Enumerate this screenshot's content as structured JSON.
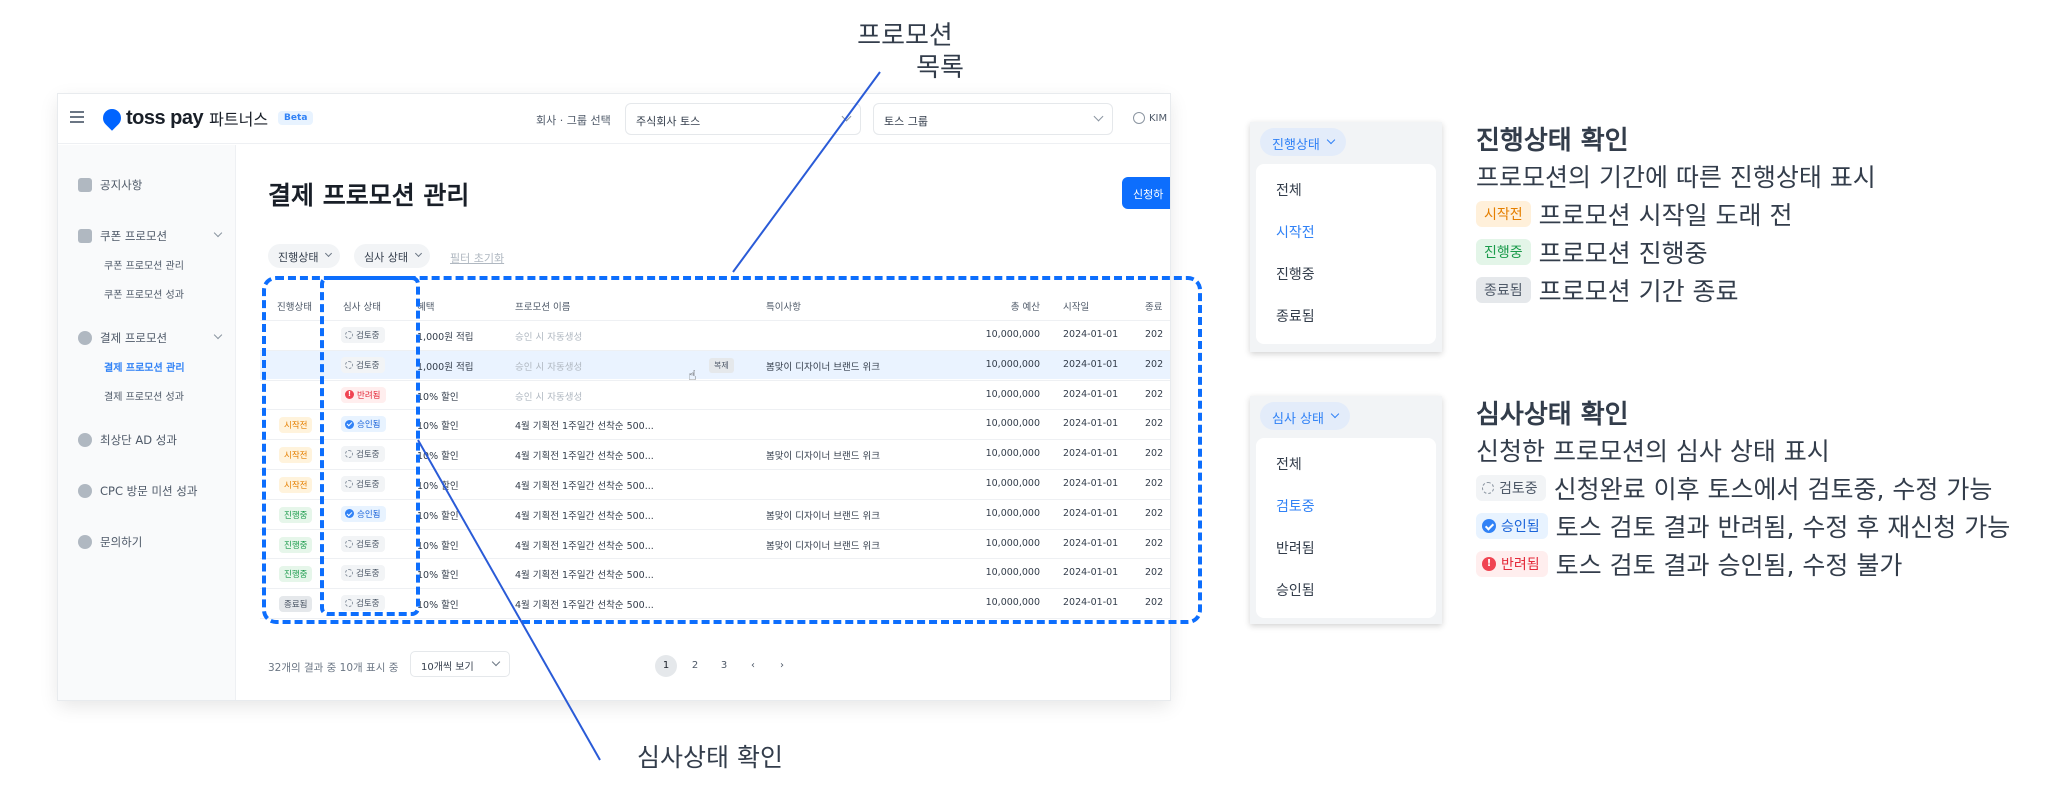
{
  "annotations": {
    "promotion_list": [
      "프로모션",
      "목록"
    ],
    "review_status_check": "심사상태 확인"
  },
  "topbar": {
    "brand": "toss pay",
    "brand_sub": "파트너스",
    "beta": "Beta",
    "company_label": "회사 · 그룹 선택",
    "company_value": "주식회사 토스",
    "group_value": "토스 그룹",
    "user": "KIM"
  },
  "sidebar": {
    "items": [
      {
        "label": "공지사항",
        "icon": "megaphone-icon"
      },
      {
        "label": "쿠폰 프로모션",
        "icon": "ticket-icon",
        "sub": [
          "쿠폰 프로모션 관리",
          "쿠폰 프로모션 성과"
        ]
      },
      {
        "label": "결제 프로모션",
        "icon": "won-icon",
        "sub": [
          "결제 프로모션 관리",
          "결제 프로모션 성과"
        ]
      },
      {
        "label": "최상단 AD 성과",
        "icon": "ad-icon"
      },
      {
        "label": "CPC 방문 미션 성과",
        "icon": "pin-icon"
      },
      {
        "label": "문의하기",
        "icon": "chat-icon"
      }
    ],
    "active": "결제 프로모션 관리"
  },
  "main": {
    "title": "결제 프로모션 관리",
    "apply_button": "신청하",
    "filters": [
      "진행상태",
      "심사 상태"
    ],
    "filter_reset": "필터 초기화",
    "columns": [
      "진행상태",
      "심사 상태",
      "혜택",
      "프로모션 이름",
      "특이사항",
      "총 예산",
      "시작일",
      "종료"
    ],
    "copy_label": "복제",
    "rows": [
      {
        "progress": "",
        "review": "검토중",
        "benefit": "1,000원 적립",
        "name": "승인 시 자동생성",
        "note": "",
        "budget": "10,000,000",
        "start": "2024-01-01",
        "end": "202"
      },
      {
        "progress": "",
        "review": "검토중",
        "benefit": "1,000원 적립",
        "name": "승인 시 자동생성",
        "note": "봄맞이 디자이너 브랜드 위크",
        "budget": "10,000,000",
        "start": "2024-01-01",
        "end": "202"
      },
      {
        "progress": "",
        "review": "반려됨",
        "benefit": "10% 할인",
        "name": "승인 시 자동생성",
        "note": "",
        "budget": "10,000,000",
        "start": "2024-01-01",
        "end": "202"
      },
      {
        "progress": "시작전",
        "review": "승인됨",
        "benefit": "10% 할인",
        "name": "4월 기획전 1주일간 선착순 500...",
        "note": "",
        "budget": "10,000,000",
        "start": "2024-01-01",
        "end": "202"
      },
      {
        "progress": "시작전",
        "review": "검토중",
        "benefit": "10% 할인",
        "name": "4월 기획전 1주일간 선착순 500...",
        "note": "봄맞이 디자이너 브랜드 위크",
        "budget": "10,000,000",
        "start": "2024-01-01",
        "end": "202"
      },
      {
        "progress": "시작전",
        "review": "검토중",
        "benefit": "10% 할인",
        "name": "4월 기획전 1주일간 선착순 500...",
        "note": "",
        "budget": "10,000,000",
        "start": "2024-01-01",
        "end": "202"
      },
      {
        "progress": "진행중",
        "review": "승인됨",
        "benefit": "10% 할인",
        "name": "4월 기획전 1주일간 선착순 500...",
        "note": "봄맞이 디자이너 브랜드 위크",
        "budget": "10,000,000",
        "start": "2024-01-01",
        "end": "202"
      },
      {
        "progress": "진행중",
        "review": "검토중",
        "benefit": "10% 할인",
        "name": "4월 기획전 1주일간 선착순 500...",
        "note": "봄맞이 디자이너 브랜드 위크",
        "budget": "10,000,000",
        "start": "2024-01-01",
        "end": "202"
      },
      {
        "progress": "진행중",
        "review": "검토중",
        "benefit": "10% 할인",
        "name": "4월 기획전 1주일간 선착순 500...",
        "note": "",
        "budget": "10,000,000",
        "start": "2024-01-01",
        "end": "202"
      },
      {
        "progress": "종료됨",
        "review": "검토중",
        "benefit": "10% 할인",
        "name": "4월 기획전 1주일간 선착순 500...",
        "note": "",
        "budget": "10,000,000",
        "start": "2024-01-01",
        "end": "202"
      }
    ],
    "result_text": "32개의 결과 중 10개 표시 중",
    "per_page": "10개씩 보기",
    "pages": [
      "1",
      "2",
      "3"
    ],
    "current_page": "1"
  },
  "legend_progress": {
    "chip": "진행상태",
    "options": [
      "전체",
      "시작전",
      "진행중",
      "종료됨"
    ],
    "selected": "시작전",
    "title": "진행상태 확인",
    "desc": "프로모션의 기간에 따른 진행상태 표시",
    "items": [
      {
        "badge": "시작전",
        "text": "프로모션 시작일 도래 전"
      },
      {
        "badge": "진행중",
        "text": "프로모션 진행중"
      },
      {
        "badge": "종료됨",
        "text": "프로모션 기간 종료"
      }
    ]
  },
  "legend_review": {
    "chip": "심사 상태",
    "options": [
      "전체",
      "검토중",
      "반려됨",
      "승인됨"
    ],
    "selected": "검토중",
    "title": "심사상태 확인",
    "desc": "신청한 프로모션의 심사 상태 표시",
    "items": [
      {
        "badge": "검토중",
        "text": "신청완료 이후 토스에서 검토중, 수정 가능"
      },
      {
        "badge": "승인됨",
        "text": "토스 검토 결과 반려됨, 수정 후 재신청 가능"
      },
      {
        "badge": "반려됨",
        "text": "토스 검토 결과 승인됨, 수정 불가"
      }
    ]
  },
  "colors": {
    "accent": "#0d6efd",
    "pre": "#e57f00",
    "progress": "#1a9b4b",
    "rejected": "#e42939",
    "approved": "#1b64da"
  }
}
